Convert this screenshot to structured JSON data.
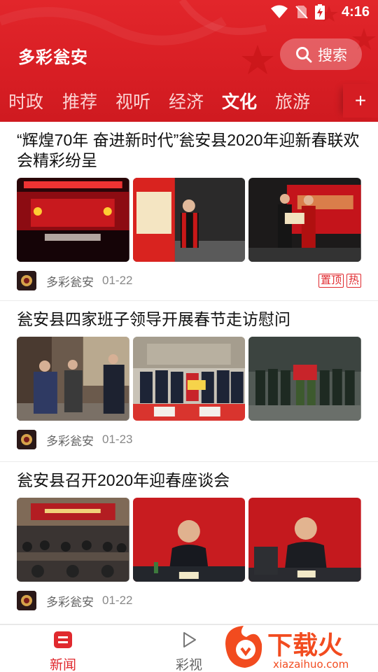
{
  "status_bar": {
    "time": "4:16"
  },
  "header": {
    "app_title": "多彩瓮安",
    "search_label": "搜索",
    "tabs": [
      {
        "label": "时政",
        "active": false
      },
      {
        "label": "推荐",
        "active": false
      },
      {
        "label": "视听",
        "active": false
      },
      {
        "label": "经济",
        "active": false
      },
      {
        "label": "文化",
        "active": true
      },
      {
        "label": "旅游",
        "active": false
      }
    ],
    "add_tab_label": "+"
  },
  "articles": [
    {
      "title": "“辉煌70年 奋进新时代”瓮安县2020年迎新春联欢会精彩纷呈",
      "source": "多彩瓮安",
      "date": "01-22",
      "badges": [
        "置顶",
        "热"
      ]
    },
    {
      "title": "瓮安县四家班子领导开展春节走访慰问",
      "source": "多彩瓮安",
      "date": "01-23",
      "badges": []
    },
    {
      "title": "瓮安县召开2020年迎春座谈会",
      "source": "多彩瓮安",
      "date": "01-22",
      "badges": []
    }
  ],
  "bottom_nav": {
    "items": [
      {
        "label": "新闻",
        "icon": "news-icon",
        "active": true
      },
      {
        "label": "彩视",
        "icon": "play-icon",
        "active": false
      }
    ]
  },
  "watermark": {
    "text": "下载火",
    "url_text": "xiazaihuo.com"
  },
  "colors": {
    "brand_red": "#d81e24",
    "badge_red": "#e0292e",
    "active_nav": "#e0292e"
  }
}
